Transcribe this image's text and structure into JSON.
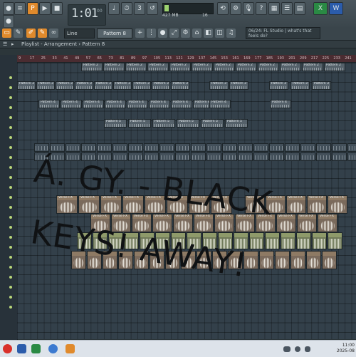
{
  "transport": {
    "time": "1:01",
    "time_sub": "00",
    "memory": "427 MB",
    "cpu": "16"
  },
  "toolbar": {
    "snap": "Line",
    "pattern": "Pattern 8",
    "news": "06/24: FL Studio | what's that feels do?"
  },
  "playlist": {
    "title": "Playlist - Arrangement › Pattern 8",
    "ruler_ticks": [
      "9",
      "17",
      "25",
      "33",
      "41",
      "49",
      "57",
      "65",
      "73",
      "81",
      "89",
      "97",
      "105",
      "113",
      "121",
      "129",
      "137",
      "145",
      "153",
      "161",
      "169",
      "177",
      "185",
      "193",
      "201",
      "209",
      "217",
      "225",
      "233",
      "241"
    ],
    "clips": {
      "pattern2": "Pattern 2",
      "pattern3": "Pattern 3",
      "pattern4": "Pattern 4",
      "pattern5": "Pattern 5",
      "verse": "Verse FX"
    }
  },
  "overlay": {
    "line1": "Á. GY. - BLACK",
    "line2": "KEYS! AWAY!"
  },
  "clock": {
    "time": "11:00",
    "date": "2025-08"
  }
}
